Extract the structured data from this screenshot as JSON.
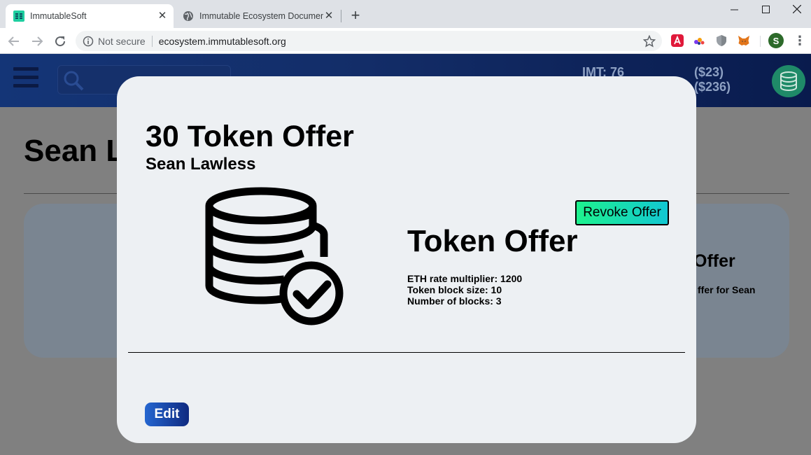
{
  "browser": {
    "tabs": [
      {
        "title": "ImmutableSoft",
        "active": true
      },
      {
        "title": "Immutable Ecosystem Documentation",
        "active": false
      }
    ],
    "security_label": "Not secure",
    "url": "ecosystem.immutablesoft.org",
    "profile_initial": "S"
  },
  "appbar": {
    "imt_balance": "IMT: 76",
    "usd_balance_1": "($23)",
    "usd_balance_2": "($236)"
  },
  "background": {
    "page_title": "Sean L",
    "card_title": "Offer",
    "card_text": "ffer for Sean"
  },
  "modal": {
    "title": "30 Token Offer",
    "subtitle": "Sean Lawless",
    "revoke_label": "Revoke Offer",
    "offer_title": "Token Offer",
    "details": [
      "ETH rate multiplier: 1200",
      "Token block size: 10",
      "Number of blocks: 3"
    ],
    "edit_label": "Edit"
  },
  "colors": {
    "appbar": "#132d68",
    "modal_bg": "#edf0f3",
    "revoke_gradient_start": "#1ef28e",
    "revoke_gradient_end": "#12c7d2",
    "edit_gradient_start": "#2566d0",
    "edit_gradient_end": "#0f2a80"
  }
}
